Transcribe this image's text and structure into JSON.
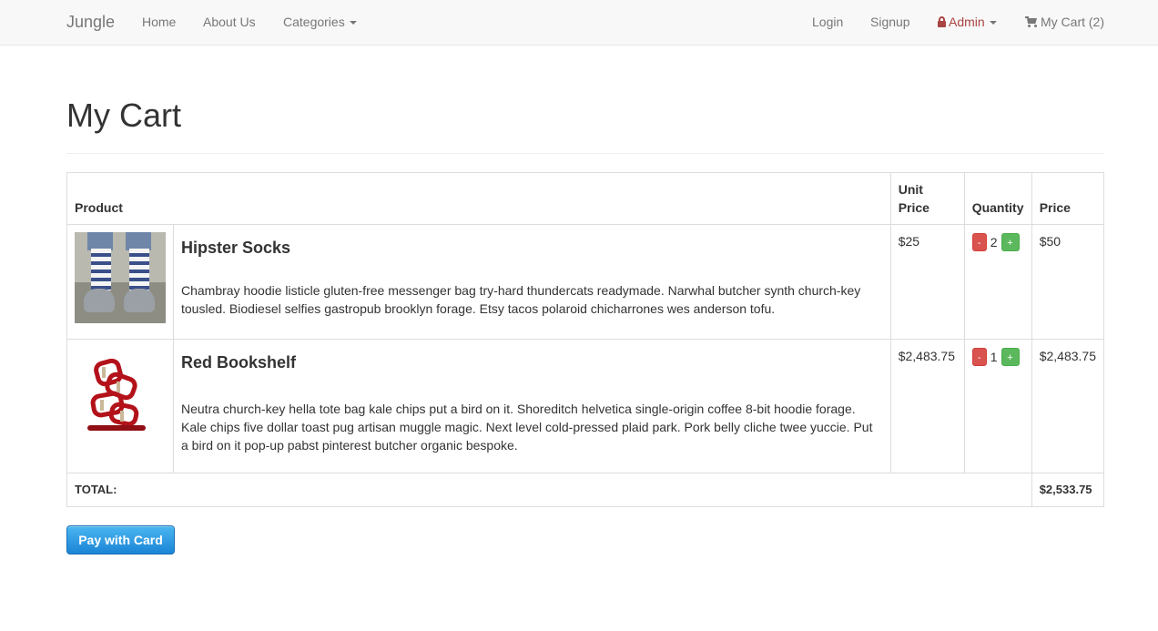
{
  "nav": {
    "brand": "Jungle",
    "home": "Home",
    "about": "About Us",
    "categories": "Categories",
    "login": "Login",
    "signup": "Signup",
    "admin": "Admin",
    "cart": "My Cart (2)"
  },
  "page": {
    "title": "My Cart"
  },
  "table": {
    "headers": {
      "product": "Product",
      "unit_price": "Unit Price",
      "quantity": "Quantity",
      "price": "Price"
    },
    "items": [
      {
        "name": "Hipster Socks",
        "description": "Chambray hoodie listicle gluten-free messenger bag try-hard thundercats readymade. Narwhal butcher synth church-key tousled. Biodiesel selfies gastropub brooklyn forage. Etsy tacos polaroid chicharrones wes anderson tofu.",
        "unit_price": "$25",
        "quantity": "2",
        "price": "$50",
        "minus": "-",
        "plus": "+"
      },
      {
        "name": "Red Bookshelf",
        "description": "Neutra church-key hella tote bag kale chips put a bird on it. Shoreditch helvetica single-origin coffee 8-bit hoodie forage. Kale chips five dollar toast pug artisan muggle magic. Next level cold-pressed plaid park. Pork belly cliche twee yuccie. Put a bird on it pop-up pabst pinterest butcher organic bespoke.",
        "unit_price": "$2,483.75",
        "quantity": "1",
        "price": "$2,483.75",
        "minus": "-",
        "plus": "+"
      }
    ],
    "total_label": "TOTAL:",
    "total_value": "$2,533.75"
  },
  "actions": {
    "pay": "Pay with Card"
  },
  "icons": {
    "admin": "lock-icon",
    "cart": "shopping-cart-icon",
    "dropdown": "caret-down-icon"
  },
  "colors": {
    "danger": "#d9534f",
    "success": "#5cb85c",
    "primary": "#1a84d6",
    "admin": "#a94442"
  }
}
